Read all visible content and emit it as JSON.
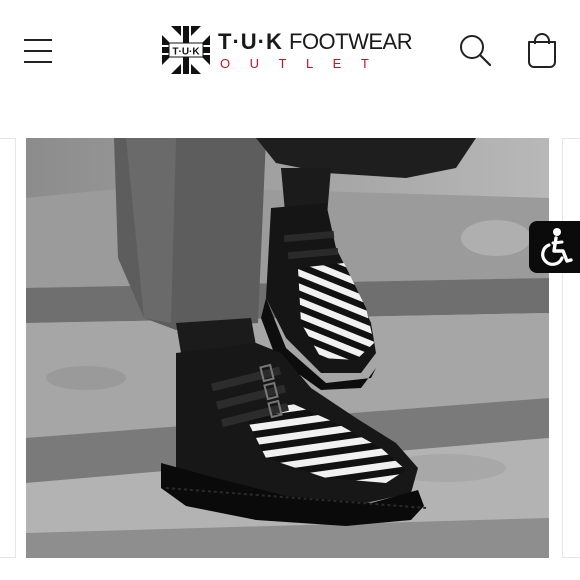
{
  "header": {
    "menu_icon": "hamburger-menu-icon",
    "logo": {
      "badge_text": "T·U·K",
      "brand": "T·U·K",
      "footwear": "FOOTWEAR",
      "sub": "OUTLET",
      "colors": {
        "brand": "#1a1a1a",
        "accent": "#c8161d"
      }
    },
    "search_icon": "search-icon",
    "cart_icon": "shopping-bag-icon"
  },
  "gallery": {
    "image_subject": "black leather creeper boots with black and white striped vamp and buckle straps on concrete steps"
  },
  "accessibility": {
    "icon": "accessibility-wheelchair-icon"
  }
}
